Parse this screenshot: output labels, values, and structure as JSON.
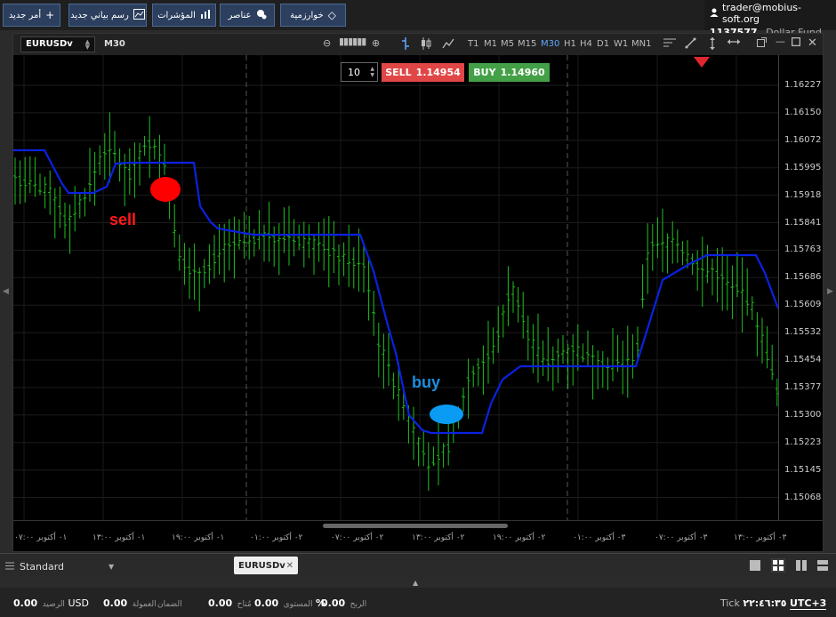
{
  "toolbar": {
    "buttons": [
      {
        "label": "أمر جديد",
        "icon": "plus-icon"
      },
      {
        "label": "رسم بياني جديد",
        "icon": "chart-icon"
      },
      {
        "label": "المؤشرات",
        "icon": "indicators-icon"
      },
      {
        "label": "عناصر",
        "icon": "elements-icon"
      },
      {
        "label": "خوارزمية",
        "icon": "diamond-icon"
      }
    ]
  },
  "account": {
    "user": "trader@mobius-soft.org",
    "balance": "1137577",
    "fund": "Dollar Fund"
  },
  "chart_window": {
    "symbol": "EURUSDv",
    "timeframe": "M30",
    "timeframes": [
      "T1",
      "M1",
      "M5",
      "M15",
      "M30",
      "H1",
      "H4",
      "D1",
      "W1",
      "MN1"
    ],
    "active_timeframe": "M30"
  },
  "trade_panel": {
    "lot": "10",
    "sell_label": "SELL",
    "sell_price": "1.14954",
    "buy_label": "BUY",
    "buy_price": "1.14960"
  },
  "annotations": {
    "sell": "sell",
    "buy": "buy"
  },
  "price_axis": [
    "1.16227",
    "1.16150",
    "1.16072",
    "1.15995",
    "1.15918",
    "1.15841",
    "1.15763",
    "1.15686",
    "1.15609",
    "1.15532",
    "1.15454",
    "1.15377",
    "1.15300",
    "1.15223",
    "1.15145",
    "1.15068"
  ],
  "time_axis": [
    "٠١ أكتوبر ٠٧:٠٠",
    "٠١ أكتوبر ١٣:٠٠",
    "٠١ أكتوبر ١٩:٠٠",
    "٠٢ أكتوبر ٠١:٠٠",
    "٠٢ أكتوبر ٠٧:٠٠",
    "٠٢ أكتوبر ١٣:٠٠",
    "٠٢ أكتوبر ١٩:٠٠",
    "٠٣ أكتوبر ٠١:٠٠",
    "٠٣ أكتوبر ٠٧:٠٠",
    "٠٣ أكتوبر ١٣:٠٠"
  ],
  "colors": {
    "candle": "#1fbf1f",
    "indicator": "#0a22e0",
    "sell_marker": "#ff0000",
    "buy_marker": "#0a9cf5",
    "sell_button": "#e04646",
    "buy_button": "#43a046"
  },
  "bottom": {
    "profile": "Standard",
    "chart_tab": "EURUSDv"
  },
  "status": {
    "balance_value": "0.00",
    "currency": "USD",
    "balance_label": "الرصيد",
    "commission_value": "0.00",
    "commission_label": "العمولة",
    "margin_value": "0.00",
    "margin_label": "الضمان",
    "free_value": "0.00",
    "free_label": "مُتاح",
    "level_value": "0.00",
    "level_unit": "%",
    "level_label": "المستوى",
    "profit_value": "0.00",
    "profit_label": "الربح",
    "tick_label": "Tick",
    "time": "٢٢:٤٦:٣٥",
    "timezone": "UTC+3"
  }
}
